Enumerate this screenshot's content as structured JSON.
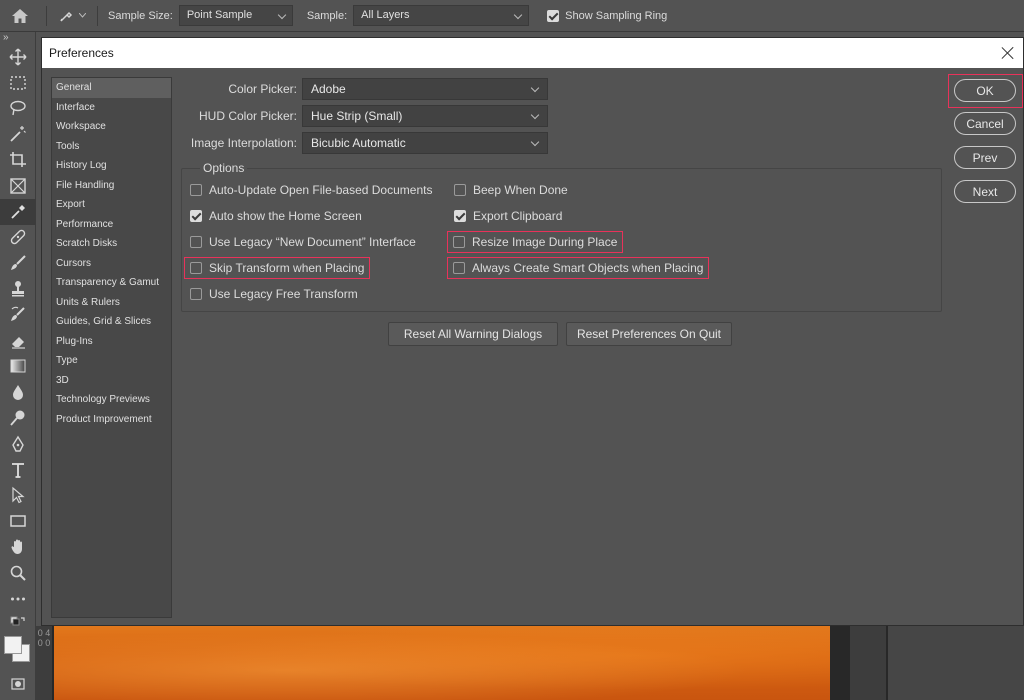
{
  "options_bar": {
    "sample_size_label": "Sample Size:",
    "sample_size_value": "Point Sample",
    "sample_label": "Sample:",
    "sample_value": "All Layers",
    "show_sampling_ring_label": "Show Sampling Ring",
    "show_sampling_ring_checked": true
  },
  "toolbar": {
    "collapse_label": "»",
    "tools": [
      "move-icon",
      "marquee-icon",
      "lasso-icon",
      "magic-wand-icon",
      "crop-icon",
      "frame-icon",
      "eyedropper-icon",
      "healing-brush-icon",
      "brush-icon",
      "clone-stamp-icon",
      "history-brush-icon",
      "eraser-icon",
      "gradient-icon",
      "blur-icon",
      "dodge-icon",
      "pen-icon",
      "type-icon",
      "path-selection-icon",
      "rectangle-icon",
      "hand-icon",
      "zoom-icon",
      "more-tools-icon"
    ],
    "active_tool": "eyedropper-icon"
  },
  "dialog": {
    "title": "Preferences",
    "nav": [
      "General",
      "Interface",
      "Workspace",
      "Tools",
      "History Log",
      "File Handling",
      "Export",
      "Performance",
      "Scratch Disks",
      "Cursors",
      "Transparency & Gamut",
      "Units & Rulers",
      "Guides, Grid & Slices",
      "Plug-Ins",
      "Type",
      "3D",
      "Technology Previews",
      "Product Improvement"
    ],
    "selected_nav": "General",
    "fields": {
      "color_picker_label": "Color Picker:",
      "color_picker_value": "Adobe",
      "hud_color_picker_label": "HUD Color Picker:",
      "hud_color_picker_value": "Hue Strip (Small)",
      "image_interpolation_label": "Image Interpolation:",
      "image_interpolation_value": "Bicubic Automatic"
    },
    "options_title": "Options",
    "options": {
      "auto_update": {
        "label": "Auto-Update Open File-based Documents",
        "checked": false
      },
      "beep": {
        "label": "Beep When Done",
        "checked": false
      },
      "auto_home": {
        "label": "Auto show the Home Screen",
        "checked": true
      },
      "export_clipboard": {
        "label": "Export Clipboard",
        "checked": true
      },
      "legacy_new_doc": {
        "label": "Use Legacy “New Document” Interface",
        "checked": false
      },
      "resize_during_place": {
        "label": "Resize Image During Place",
        "checked": false
      },
      "skip_transform": {
        "label": "Skip Transform when Placing",
        "checked": false
      },
      "always_smart_objects": {
        "label": "Always Create Smart Objects when Placing",
        "checked": false
      },
      "legacy_free_transform": {
        "label": "Use Legacy Free Transform",
        "checked": false
      }
    },
    "reset_warnings_label": "Reset All Warning Dialogs",
    "reset_prefs_label": "Reset Preferences On Quit",
    "buttons": {
      "ok": "OK",
      "cancel": "Cancel",
      "prev": "Prev",
      "next": "Next"
    }
  },
  "canvas": {
    "ruler_text": "0 4 0 0",
    "highlight_color": "#e8325a"
  }
}
